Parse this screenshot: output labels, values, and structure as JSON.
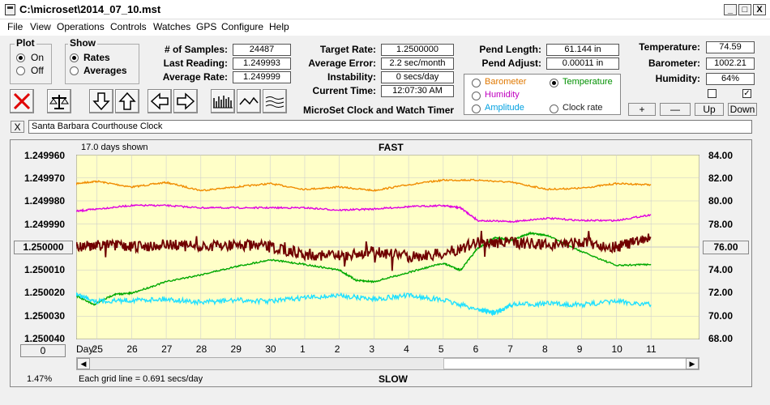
{
  "window": {
    "title": "C:\\microset\\2014_07_10.mst"
  },
  "window_controls": {
    "minimize": "_",
    "maximize": "□",
    "close": "X"
  },
  "menu": [
    "File",
    "View",
    "Operations",
    "Controls",
    "Watches",
    "GPS",
    "Configure",
    "Help"
  ],
  "plot_group": {
    "label": "Plot",
    "options": [
      "On",
      "Off"
    ],
    "selected": "On"
  },
  "show_group": {
    "label": "Show",
    "options": [
      "Rates",
      "Averages"
    ],
    "selected": "Rates"
  },
  "stats": [
    {
      "label": "# of Samples:",
      "value": "24487"
    },
    {
      "label": "Last Reading:",
      "value": "1.249993"
    },
    {
      "label": "Average Rate:",
      "value": "1.249999"
    }
  ],
  "targets": [
    {
      "label": "Target Rate:",
      "value": "1.2500000"
    },
    {
      "label": "Average Error:",
      "value": "2.2 sec/month"
    },
    {
      "label": "Instability:",
      "value": "0 secs/day"
    },
    {
      "label": "Current Time:",
      "value": "12:07:30 AM"
    }
  ],
  "app_name": "MicroSet Clock and Watch Timer",
  "pendulum": [
    {
      "label": "Pend Length:",
      "value": "61.144 in"
    },
    {
      "label": "Pend Adjust:",
      "value": "0.00011 in"
    }
  ],
  "sensor_select": {
    "options": [
      {
        "label": "Barometer",
        "color": "#e07800",
        "selected": false
      },
      {
        "label": "Temperature",
        "color": "#009000",
        "selected": true
      },
      {
        "label": "Humidity",
        "color": "#c000c0",
        "selected": false
      },
      {
        "label": "Clock rate",
        "color": "#202020",
        "selected": false
      },
      {
        "label": "Amplitude",
        "color": "#00a0e0",
        "selected": false
      }
    ]
  },
  "environment": [
    {
      "label": "Temperature:",
      "value": "74.59"
    },
    {
      "label": "Barometer:",
      "value": "1002.21"
    },
    {
      "label": "Humidity:",
      "value": "64%"
    }
  ],
  "checkboxes": {
    "left_checked": false,
    "right_checked": true
  },
  "adjust_buttons": [
    "+",
    "—",
    "Up",
    "Down"
  ],
  "notes": {
    "clear_label": "X",
    "text": "Santa Barbara Courthouse Clock"
  },
  "chart_header": {
    "days_shown": "17.0 days shown",
    "top_label": "FAST",
    "bottom_label": "SLOW"
  },
  "chart_footer": {
    "percent": "1.47%",
    "grid_note": "Each grid line = 0.691 secs/day",
    "center_left": "1.250000",
    "center_right": "76.00",
    "left_button": "0",
    "day_label": "Day:"
  },
  "chart_data": {
    "type": "line",
    "x_unit": "day",
    "x_ticks": [
      "25",
      "26",
      "27",
      "28",
      "29",
      "30",
      "1",
      "2",
      "3",
      "4",
      "5",
      "6",
      "7",
      "8",
      "9",
      "10",
      "11"
    ],
    "y_left_ticks": [
      "1.249960",
      "1.249970",
      "1.249980",
      "1.249990",
      "1.250000",
      "1.250010",
      "1.250020",
      "1.250030",
      "1.250040"
    ],
    "y_left_ylim": [
      1.25004,
      1.24996
    ],
    "y_right_ticks": [
      "84.00",
      "82.00",
      "80.00",
      "78.00",
      "76.00",
      "74.00",
      "72.00",
      "70.00",
      "68.00"
    ],
    "y_right_ylim": [
      68.0,
      84.0
    ],
    "grid": true,
    "series": [
      {
        "name": "Barometer",
        "color": "#f08c00",
        "axis": "right",
        "x": [
          24.4,
          25,
          26,
          27,
          28,
          29,
          30,
          31,
          32,
          33,
          34,
          35,
          36,
          37,
          38,
          39,
          40,
          41
        ],
        "y": [
          81.5,
          81.7,
          81.2,
          81.6,
          80.9,
          81.2,
          81.5,
          81.0,
          81.2,
          80.9,
          81.4,
          81.8,
          81.8,
          81.6,
          81.0,
          81.1,
          81.5,
          81.4
        ]
      },
      {
        "name": "Humidity",
        "color": "#e000e0",
        "axis": "right",
        "x": [
          24.4,
          25,
          26,
          27,
          28,
          29,
          30,
          31,
          32,
          33,
          34,
          35,
          35.5,
          36,
          37,
          38,
          39,
          40,
          41
        ],
        "y": [
          79.1,
          79.3,
          79.6,
          79.6,
          79.4,
          79.4,
          79.4,
          79.4,
          79.2,
          79.3,
          79.5,
          79.6,
          79.4,
          78.3,
          78.2,
          78.5,
          78.3,
          78.3,
          78.8
        ]
      },
      {
        "name": "Temperature",
        "color": "#00a800",
        "axis": "right",
        "x": [
          24.4,
          24.9,
          25.5,
          26,
          27,
          28,
          29,
          30,
          31,
          32,
          32.5,
          33,
          34,
          35,
          35.5,
          36,
          36.5,
          37,
          37.5,
          38,
          39,
          40,
          41
        ],
        "y": [
          71.8,
          71.0,
          71.9,
          72.0,
          73.0,
          73.6,
          74.3,
          74.9,
          74.5,
          74.0,
          73.1,
          73.0,
          73.8,
          74.6,
          74.0,
          75.9,
          76.8,
          76.6,
          77.2,
          77.0,
          75.6,
          74.4,
          74.5
        ]
      },
      {
        "name": "Amplitude",
        "color": "#20e0ff",
        "axis": "right",
        "x": [
          24.4,
          25,
          26,
          27,
          28,
          29,
          30,
          31,
          32,
          33,
          34,
          35,
          36,
          36.5,
          37,
          38,
          39,
          40,
          41
        ],
        "y": [
          71.9,
          71.3,
          71.4,
          71.5,
          71.2,
          71.4,
          71.3,
          71.6,
          71.8,
          71.5,
          71.8,
          71.4,
          70.6,
          70.3,
          71.0,
          71.1,
          71.0,
          71.3,
          71.0
        ]
      },
      {
        "name": "Clock rate",
        "color": "#700000",
        "axis": "left",
        "x": [
          24.4,
          25,
          26,
          27,
          28,
          29,
          30,
          31,
          32,
          33,
          34,
          35,
          36,
          37,
          38,
          39,
          40,
          41
        ],
        "y": [
          1.25,
          1.249999,
          1.25,
          1.249999,
          1.25,
          1.249999,
          1.25,
          1.250003,
          1.250004,
          1.250002,
          1.250004,
          1.250003,
          1.249998,
          1.249998,
          1.249999,
          1.249998,
          1.25,
          1.249996
        ]
      }
    ]
  }
}
